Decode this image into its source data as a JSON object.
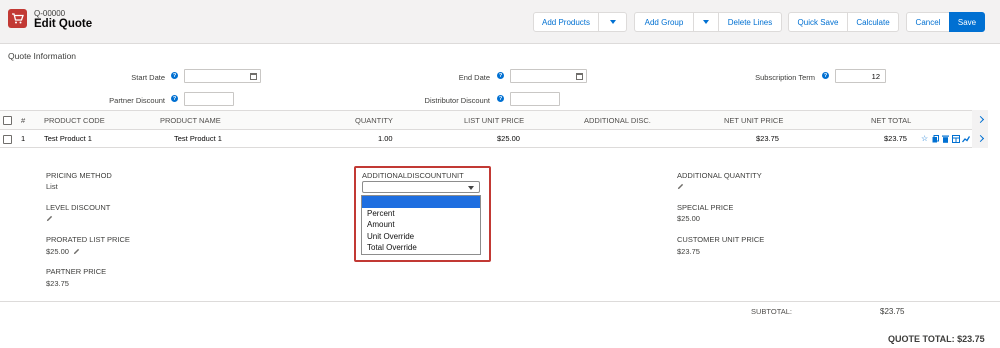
{
  "header": {
    "quote_number": "Q-00000",
    "title": "Edit Quote",
    "buttons": {
      "add_products": "Add Products",
      "add_group": "Add Group",
      "delete_lines": "Delete Lines",
      "quick_save": "Quick Save",
      "calculate": "Calculate",
      "cancel": "Cancel",
      "save": "Save"
    }
  },
  "quote_information": {
    "section_title": "Quote Information",
    "start_date_label": "Start Date",
    "start_date_value": "",
    "end_date_label": "End Date",
    "end_date_value": "",
    "subscription_term_label": "Subscription Term",
    "subscription_term_value": "12",
    "partner_discount_label": "Partner Discount",
    "partner_discount_value": "",
    "distributor_discount_label": "Distributor Discount",
    "distributor_discount_value": ""
  },
  "grid": {
    "columns": {
      "index": "#",
      "product_code": "PRODUCT CODE",
      "product_name": "PRODUCT NAME",
      "quantity": "QUANTITY",
      "list_unit_price": "LIST UNIT PRICE",
      "additional_disc": "ADDITIONAL DISC.",
      "net_unit_price": "NET UNIT PRICE",
      "net_total": "NET TOTAL"
    },
    "rows": [
      {
        "index": "1",
        "product_code": "Test Product 1",
        "product_name": "Test Product 1",
        "quantity": "1.00",
        "list_unit_price": "$25.00",
        "additional_disc": "",
        "net_unit_price": "$23.75",
        "net_total": "$23.75"
      }
    ]
  },
  "details": {
    "pricing_method_label": "PRICING METHOD",
    "pricing_method_value": "List",
    "level_discount_label": "LEVEL DISCOUNT",
    "prorated_list_price_label": "PRORATED LIST PRICE",
    "prorated_list_price_value": "$25.00",
    "partner_price_label": "PARTNER PRICE",
    "partner_price_value": "$23.75",
    "additional_discount_unit_label": "ADDITIONALDISCOUNTUNIT",
    "additional_discount_unit_value": "",
    "additional_discount_unit_options": [
      "",
      "Percent",
      "Amount",
      "Unit Override",
      "Total Override"
    ],
    "additional_quantity_label": "ADDITIONAL QUANTITY",
    "special_price_label": "SPECIAL PRICE",
    "special_price_value": "$25.00",
    "customer_unit_price_label": "CUSTOMER UNIT PRICE",
    "customer_unit_price_value": "$23.75"
  },
  "totals": {
    "subtotal_label": "SUBTOTAL:",
    "subtotal_value": "$23.75",
    "quote_total_label": "QUOTE TOTAL: $23.75"
  },
  "colors": {
    "brand_blue": "#0070d2",
    "highlight_red": "#c23934",
    "dropdown_selected": "#1e6ee0"
  }
}
